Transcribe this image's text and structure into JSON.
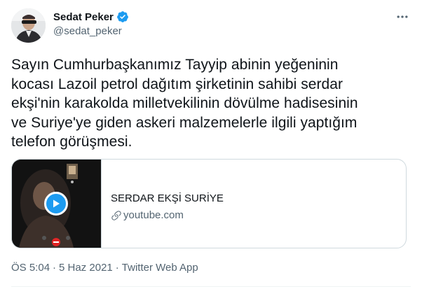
{
  "author": {
    "name": "Sedat Peker",
    "handle": "@sedat_peker",
    "verified": true
  },
  "tweet": {
    "text": "Sayın Cumhurbaşkanımız Tayyip abinin yeğeninin\nkocası Lazoil petrol dağıtım şirketinin sahibi serdar\nekşi'nin karakolda milletvekilinin dövülme hadisesinin\nve Suriye'ye giden askeri malzemelerle ilgili yaptığım\ntelefon görüşmesi."
  },
  "card": {
    "title": "SERDAR EKŞİ SURİYE",
    "domain": "youtube.com"
  },
  "meta": {
    "time": "ÖS 5:04",
    "date": "5 Haz 2021",
    "separator": "·",
    "source": "Twitter Web App"
  },
  "colors": {
    "accent": "#1d9bf0",
    "text": "#0f1419",
    "secondary": "#536471",
    "border": "#cfd9de"
  },
  "icons": {
    "verified": "verified-badge-icon",
    "more": "more-options-icon",
    "play": "play-icon",
    "link": "link-icon"
  }
}
